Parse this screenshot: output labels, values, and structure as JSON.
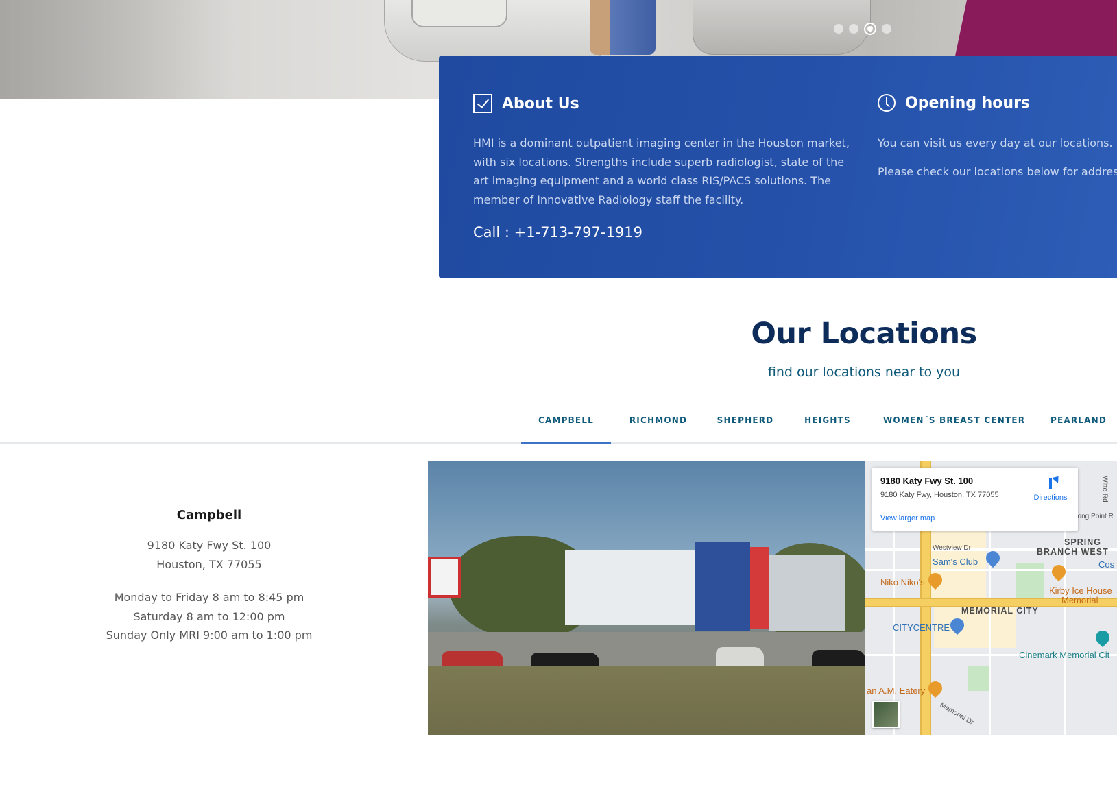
{
  "hero": {
    "slider_dots": [
      {
        "state": "inactive"
      },
      {
        "state": "inactive"
      },
      {
        "state": "active"
      },
      {
        "state": "inactive"
      }
    ],
    "accent_color": "#8a1b5a"
  },
  "about": {
    "title": "About Us",
    "icon": "checkbox-icon",
    "text": "HMI is a dominant outpatient imaging center in the Houston market, with six locations. Strengths include superb radiologist, state of the art imaging equipment and a world class RIS/PACS solutions. The member of Innovative Radiology staff the facility.",
    "call": "Call : +1-713-797-1919"
  },
  "hours": {
    "title": "Opening hours",
    "icon": "clock-icon",
    "line1": "You can visit us every day at our locations.",
    "line2": "Please check our locations below for addres"
  },
  "locations": {
    "title": "Our Locations",
    "subtitle": "find our locations near to you",
    "tabs": [
      {
        "label": "CAMPBELL",
        "active": true
      },
      {
        "label": "RICHMOND",
        "active": false
      },
      {
        "label": "SHEPHERD",
        "active": false
      },
      {
        "label": "HEIGHTS",
        "active": false
      },
      {
        "label": "WOMEN´S BREAST CENTER",
        "active": false
      },
      {
        "label": "PEARLAND",
        "active": false
      }
    ],
    "selected": {
      "name": "Campbell",
      "address_line1": "9180 Katy Fwy St. 100",
      "address_line2": "Houston, TX 77055",
      "hours_line1": "Monday to Friday 8 am to 8:45 pm",
      "hours_line2": "Saturday 8 am to 12:00 pm",
      "hours_line3": "Sunday Only MRI 9:00 am to 1:00 pm"
    }
  },
  "map": {
    "card_title": "9180 Katy Fwy St. 100",
    "card_address": "9180 Katy Fwy, Houston, TX 77055",
    "view_larger": "View larger map",
    "directions": "Directions",
    "labels": {
      "westview": "Westview Dr",
      "spring_branch_1": "SPRING",
      "spring_branch_2": "BRANCH WEST",
      "sams": "Sam's Club",
      "niko": "Niko Niko's",
      "kirby_1": "Kirby Ice House",
      "kirby_2": "Memorial",
      "memorial_city": "MEMORIAL CITY",
      "citycentre": "CITYCENTRE",
      "cinemark": "Cinemark Memorial Cit",
      "am_eatery": "an A.M. Eatery",
      "memorial_dr": "Memorial Dr",
      "long_point": "Long Point R",
      "witte": "Witte Rd",
      "cos": "Cos"
    }
  }
}
